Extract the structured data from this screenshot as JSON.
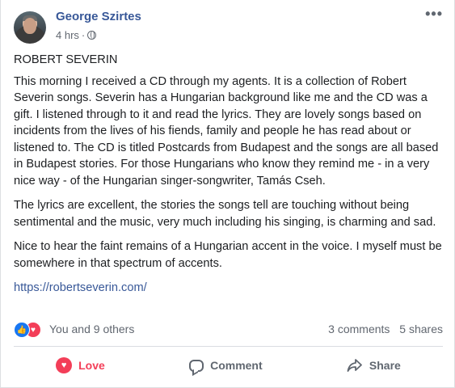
{
  "post": {
    "author": "George Szirtes",
    "time": "4 hrs",
    "time_separator": "·",
    "privacy_icon": "globe-icon",
    "more_icon": "•••",
    "title": "ROBERT SEVERIN",
    "paragraphs": [
      "This morning I received a CD through my agents. It is a collection of Robert Severin songs. Severin has a Hungarian background like me and the CD was a gift. I listened through to it and read the lyrics. They are lovely songs based on incidents from the lives of his fiends, family and people he has read about or listened to. The CD is titled Postcards from Budapest and the songs are all based in Budapest stories. For those Hungarians who know they remind me - in a very nice way - of the Hungarian singer-songwriter, Tamás Cseh.",
      "The lyrics are excellent, the stories the songs tell are touching without being sentimental and the music, very much including his singing, is charming and sad.",
      "Nice to hear the faint remains of a Hungarian accent in the voice. I myself must be somewhere in that spectrum of accents."
    ],
    "link": "https://robertseverin.com/"
  },
  "reactions": {
    "summary": "You and 9 others",
    "comments": "3 comments",
    "shares": "5 shares",
    "like_glyph": "👍",
    "love_glyph": "♥"
  },
  "actions": {
    "love_label": "Love",
    "comment_label": "Comment",
    "share_label": "Share"
  },
  "colors": {
    "link": "#385898",
    "love": "#f33e58",
    "like": "#1877f2",
    "muted": "#616770"
  }
}
